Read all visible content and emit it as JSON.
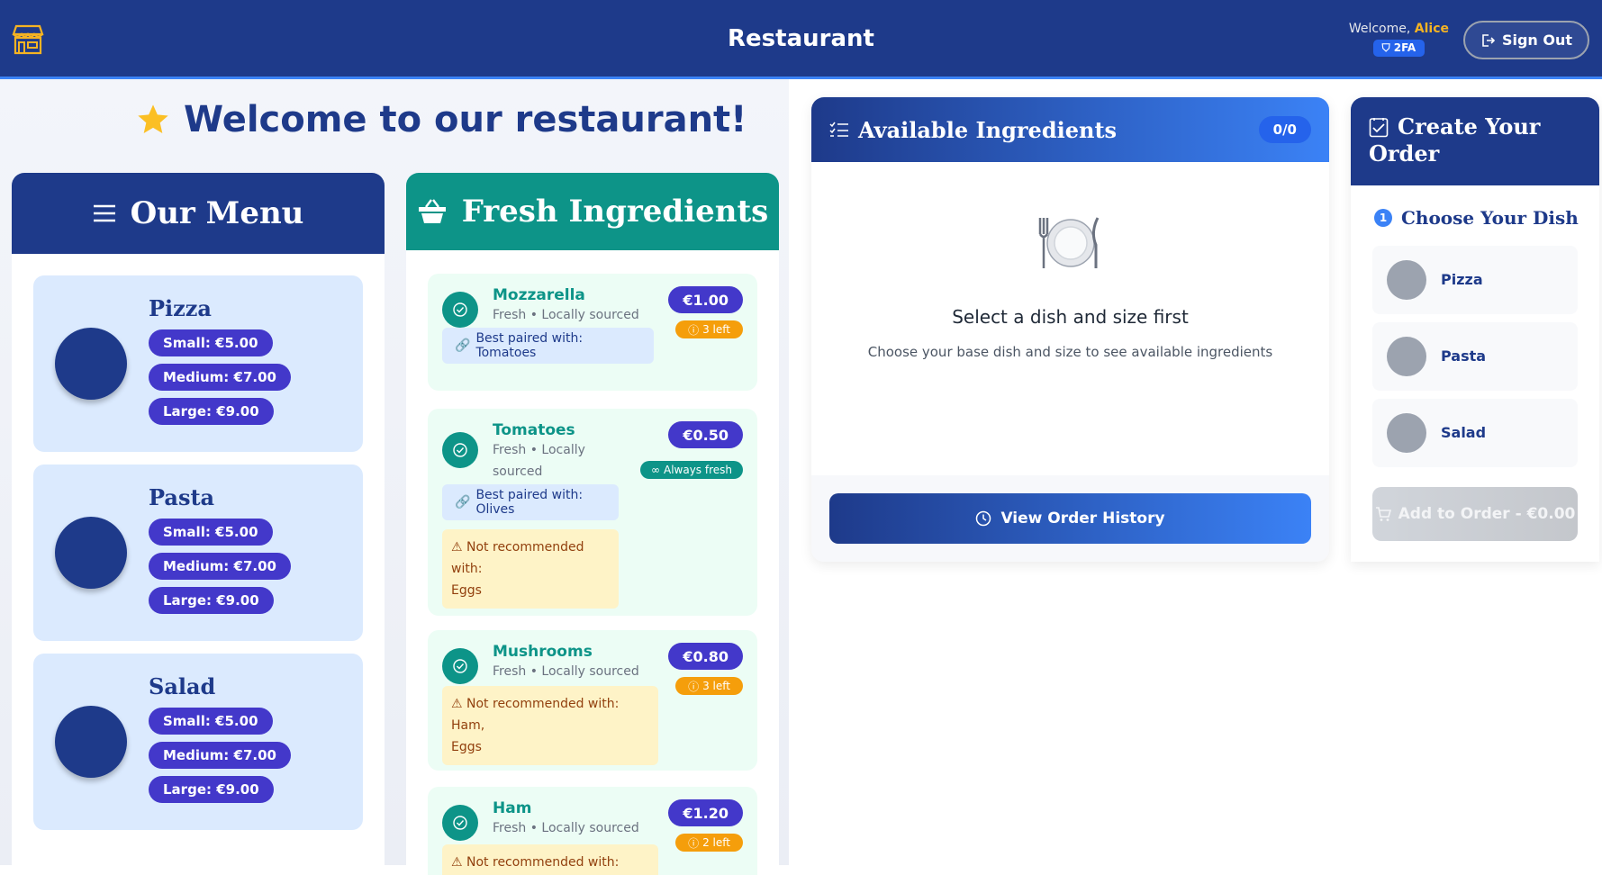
{
  "header": {
    "title": "Restaurant",
    "welcome_prefix": "Welcome,",
    "user_name": "Alice",
    "badge_2fa": "2FA",
    "signout_label": "Sign Out"
  },
  "hero": {
    "title": "Welcome to our restaurant!"
  },
  "menu": {
    "title": "Our Menu",
    "items": [
      {
        "name": "Pizza",
        "sizes": [
          "Small: €5.00",
          "Medium: €7.00",
          "Large: €9.00"
        ]
      },
      {
        "name": "Pasta",
        "sizes": [
          "Small: €5.00",
          "Medium: €7.00",
          "Large: €9.00"
        ]
      },
      {
        "name": "Salad",
        "sizes": [
          "Small: €5.00",
          "Medium: €7.00",
          "Large: €9.00"
        ]
      }
    ]
  },
  "ingredients": {
    "title": "Fresh Ingredients",
    "items": [
      {
        "name": "Mozzarella",
        "sub": "Fresh • Locally sourced",
        "price": "€1.00",
        "stock": "3 left",
        "pair": "Best paired with: Tomatoes"
      },
      {
        "name": "Tomatoes",
        "sub_line1": "Fresh • Locally",
        "sub_line2": "sourced",
        "price": "€0.50",
        "fresh": "Always fresh",
        "pair": "Best paired with: Olives",
        "warn_line1": "Not recommended with:",
        "warn_line2": "Eggs"
      },
      {
        "name": "Mushrooms",
        "sub": "Fresh • Locally sourced",
        "price": "€0.80",
        "stock": "3 left",
        "warn_line1": "Not recommended with: Ham,",
        "warn_line2": "Eggs"
      },
      {
        "name": "Ham",
        "sub": "Fresh • Locally sourced",
        "price": "€1.20",
        "stock": "2 left",
        "warn_line1": "Not recommended with:"
      }
    ]
  },
  "available": {
    "title": "Available Ingredients",
    "count": "0/0",
    "empty_title": "Select a dish and size first",
    "empty_sub": "Choose your base dish and size to see available ingredients",
    "history_button": "View Order History"
  },
  "order": {
    "title_line1": "Create Your",
    "title_line2": "Order",
    "step_number": "1",
    "step_label": "Choose Your Dish",
    "choices": [
      "Pizza",
      "Pasta",
      "Salad"
    ],
    "add_button": "Add to Order - €0.00"
  },
  "colors": {
    "navy": "#1e3a8a",
    "teal": "#0d9488",
    "indigo": "#4338ca",
    "amber": "#f59e0b",
    "accent_blue": "#3b82f6"
  }
}
